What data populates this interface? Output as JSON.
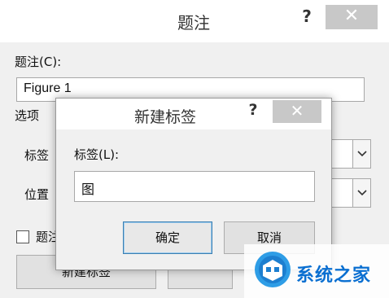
{
  "caption_dialog": {
    "title": "题注",
    "help_glyph": "?",
    "close_glyph": "✕",
    "caption_label": "题注(C):",
    "caption_value": "Figure 1",
    "options_label": "选项",
    "label_row_label": "标签",
    "position_row_label": "位置",
    "exclude_label_text": "题注",
    "new_label_button": "新建标签",
    "exclude_checked": false
  },
  "new_label_dialog": {
    "title": "新建标签",
    "help_glyph": "?",
    "close_glyph": "✕",
    "field_label": "标签(L):",
    "field_value": "图",
    "ok_button": "确定",
    "cancel_button": "取消"
  },
  "watermark": {
    "text": "系统之家"
  },
  "colors": {
    "dialog_bg": "#f0f0f0",
    "titlebar_bg": "#ffffff",
    "close_button_bg": "#c8c8c8",
    "default_button_border": "#3c7fb1",
    "watermark_text": "#0a6fd1"
  }
}
